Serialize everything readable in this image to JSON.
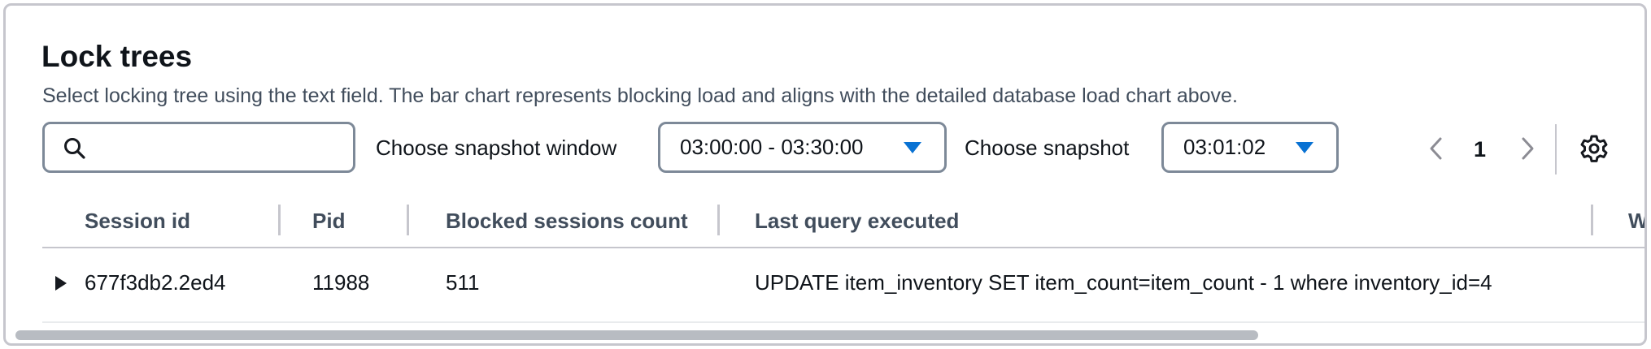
{
  "panel": {
    "title": "Lock trees",
    "description": "Select locking tree using the text field. The bar chart represents blocking load and aligns with the detailed database load chart above."
  },
  "filters": {
    "search": {
      "placeholder": "",
      "value": "",
      "icon": "search-icon"
    },
    "snapshot_window_label": "Choose snapshot window",
    "snapshot_window_value": "03:00:00 - 03:30:00",
    "snapshot_label": "Choose snapshot",
    "snapshot_value": "03:01:02"
  },
  "pagination": {
    "current_page": "1",
    "prev_icon": "chevron-left-icon",
    "next_icon": "chevron-right-icon"
  },
  "settings_icon": "gear-icon",
  "table": {
    "columns": [
      "Session id",
      "Pid",
      "Blocked sessions count",
      "Last query executed",
      "W"
    ],
    "rows": [
      {
        "session_id": "677f3db2.2ed4",
        "pid": "11988",
        "blocked_sessions_count": "511",
        "last_query": "UPDATE item_inventory SET item_count=item_count - 1 where inventory_id=4"
      }
    ]
  },
  "colors": {
    "accent": "#0972d3",
    "border": "#7d8998",
    "divider": "#c6c6cd",
    "header_text": "#414d5c",
    "text": "#0f141a"
  }
}
